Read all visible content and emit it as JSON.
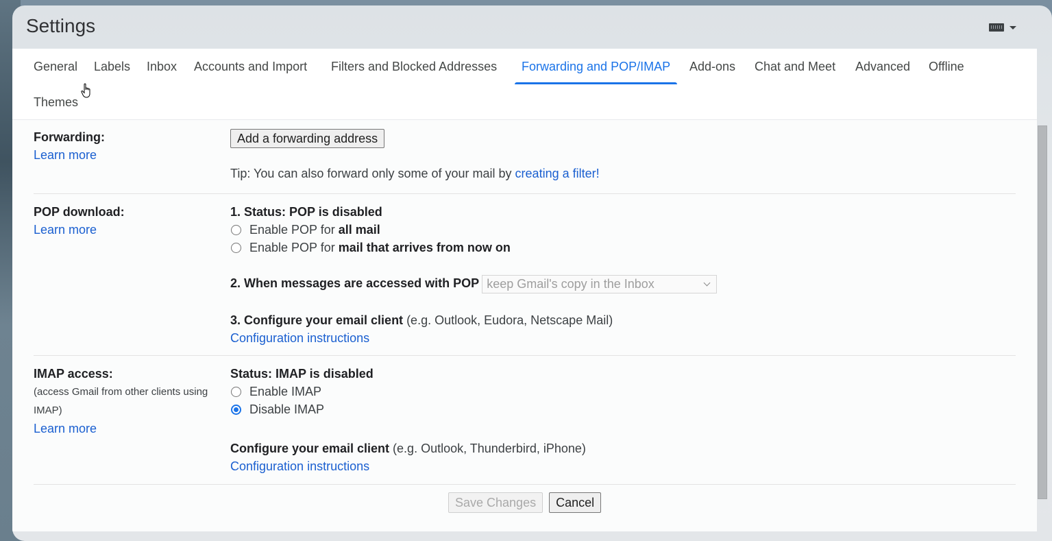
{
  "window": {
    "title": "Settings",
    "input_tools_icon": "keyboard-icon"
  },
  "tabs": [
    {
      "label": "General",
      "active": false
    },
    {
      "label": "Labels",
      "active": false
    },
    {
      "label": "Inbox",
      "active": false
    },
    {
      "label": "Accounts and Import",
      "active": false
    },
    {
      "label": "Filters and Blocked Addresses",
      "active": false
    },
    {
      "label": "Forwarding and POP/IMAP",
      "active": true
    },
    {
      "label": "Add-ons",
      "active": false
    },
    {
      "label": "Chat and Meet",
      "active": false
    },
    {
      "label": "Advanced",
      "active": false
    },
    {
      "label": "Offline",
      "active": false
    },
    {
      "label": "Themes",
      "active": false
    }
  ],
  "forwarding": {
    "title": "Forwarding:",
    "learn_more": "Learn more",
    "add_button": "Add a forwarding address",
    "tip_text": "Tip: You can also forward only some of your mail by ",
    "tip_link": "creating a filter!"
  },
  "pop": {
    "title": "POP download:",
    "learn_more": "Learn more",
    "status": "1. Status: POP is disabled",
    "option_prefix": "Enable POP for ",
    "option1_bold": "all mail",
    "option2_bold": "mail that arrives from now on",
    "when_label": "2. When messages are accessed with POP",
    "when_select_value": "keep Gmail's copy in the Inbox",
    "configure_bold": "3. Configure your email client",
    "configure_rest": " (e.g. Outlook, Eudora, Netscape Mail)",
    "config_link": "Configuration instructions"
  },
  "imap": {
    "title": "IMAP access:",
    "desc_line1": "(access Gmail from other clients using",
    "desc_line2": "IMAP)",
    "learn_more": "Learn more",
    "status": "Status: IMAP is disabled",
    "enable_label": "Enable IMAP",
    "disable_label": "Disable IMAP",
    "selected": "Disable IMAP",
    "configure_bold": "Configure your email client",
    "configure_rest": " (e.g. Outlook, Thunderbird, iPhone)",
    "config_link": "Configuration instructions"
  },
  "footer": {
    "save_label": "Save Changes",
    "cancel_label": "Cancel"
  },
  "colors": {
    "accent": "#1a73e8",
    "link": "#1a5fd0"
  }
}
